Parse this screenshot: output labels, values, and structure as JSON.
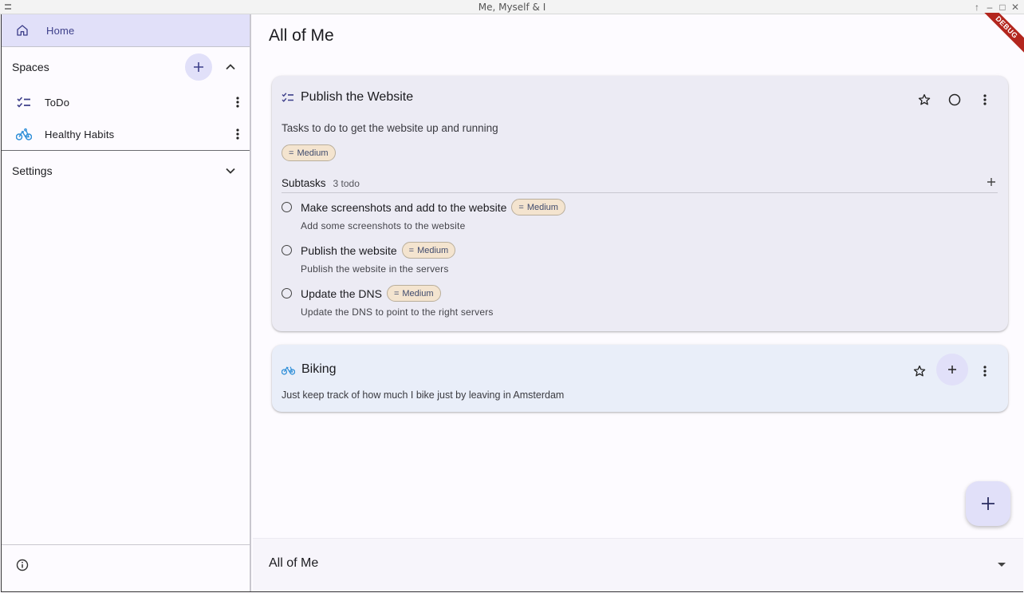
{
  "window": {
    "title": "Me, Myself & I",
    "debug_banner": "DEBUG"
  },
  "sidebar": {
    "home_label": "Home",
    "spaces_label": "Spaces",
    "spaces": [
      {
        "label": "ToDo",
        "icon": "checklist-icon"
      },
      {
        "label": "Healthy Habits",
        "icon": "bike-icon"
      }
    ],
    "settings_label": "Settings"
  },
  "main": {
    "page_title": "All of Me",
    "cards": [
      {
        "title": "Publish the Website",
        "icon": "checklist-icon",
        "description": "Tasks to do to get the website up and running",
        "priority": "Medium",
        "subtasks_label": "Subtasks",
        "subtasks_count": "3 todo",
        "subtasks": [
          {
            "name": "Make screenshots and add to the website",
            "priority": "Medium",
            "description": "Add some screenshots to the website"
          },
          {
            "name": "Publish the website",
            "priority": "Medium",
            "description": "Publish the website in the servers"
          },
          {
            "name": "Update the DNS",
            "priority": "Medium",
            "description": "Update the DNS to point to the right servers"
          }
        ]
      },
      {
        "title": "Biking",
        "icon": "bike-icon",
        "description": "Just keep track of how much I bike just by leaving in Amsterdam"
      }
    ],
    "bottom_selector": "All of Me"
  },
  "colors": {
    "accent": "#e1e0f9",
    "chip_bg": "#f4e4cf",
    "card_bg": "#ecebf4",
    "bike_blue": "#2f8fd8",
    "debug_red": "#b3261e"
  }
}
